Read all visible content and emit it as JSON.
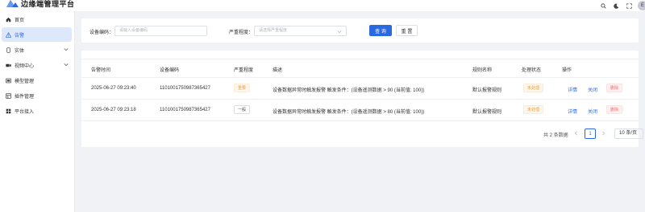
{
  "header": {
    "app_title": "边缘端管理平台",
    "avatar_text": "E",
    "icons": [
      "search-icon",
      "moon-icon",
      "fullscreen-icon"
    ],
    "brand_color": "#2a6ae0"
  },
  "sidebar": {
    "items": [
      {
        "label": "首页",
        "icon": "home-icon"
      },
      {
        "label": "告警",
        "icon": "warning-icon",
        "active": true
      },
      {
        "label": "实体",
        "icon": "device-icon",
        "expandable": true
      },
      {
        "label": "视频中心",
        "icon": "video-icon",
        "expandable": true
      },
      {
        "label": "模型管理",
        "icon": "model-icon"
      },
      {
        "label": "插件管理",
        "icon": "plugin-icon"
      },
      {
        "label": "平台接入",
        "icon": "platform-icon"
      }
    ]
  },
  "filters": {
    "device_code_label": "设备编码：",
    "device_code_placeholder": "请输入设备编码",
    "severity_label": "严重程度：",
    "severity_placeholder": "请选择严重程度",
    "query_button": "查 询",
    "reset_button": "重 置"
  },
  "table": {
    "columns": [
      "告警时间",
      "设备编码",
      "严重程度",
      "描述",
      "规则名称",
      "处理状态",
      "操作"
    ],
    "rows": [
      {
        "time": "2025-06-27 09:23:40",
        "device_code": "1101001750987365427",
        "severity": "重要",
        "description": "设备数据异常时触发报警 触发条件：(设备遥测数据 > 90 (当前值: 100))",
        "rule": "默认报警规则",
        "status": "未处理",
        "actions": [
          "详情",
          "关闭",
          "删除"
        ]
      },
      {
        "time": "2025-06-27 09:23:18",
        "device_code": "1101001750987365427",
        "severity": "一般",
        "description": "设备数据异常时触发报警 触发条件：(设备遥测数据 > 80 (当前值: 100))",
        "rule": "默认报警规则",
        "status": "未处理",
        "actions": [
          "详情",
          "关闭",
          "删除"
        ]
      }
    ]
  },
  "pagination": {
    "total_text": "共 2 条数据",
    "current_page": "1",
    "page_size": "10 条/页"
  }
}
